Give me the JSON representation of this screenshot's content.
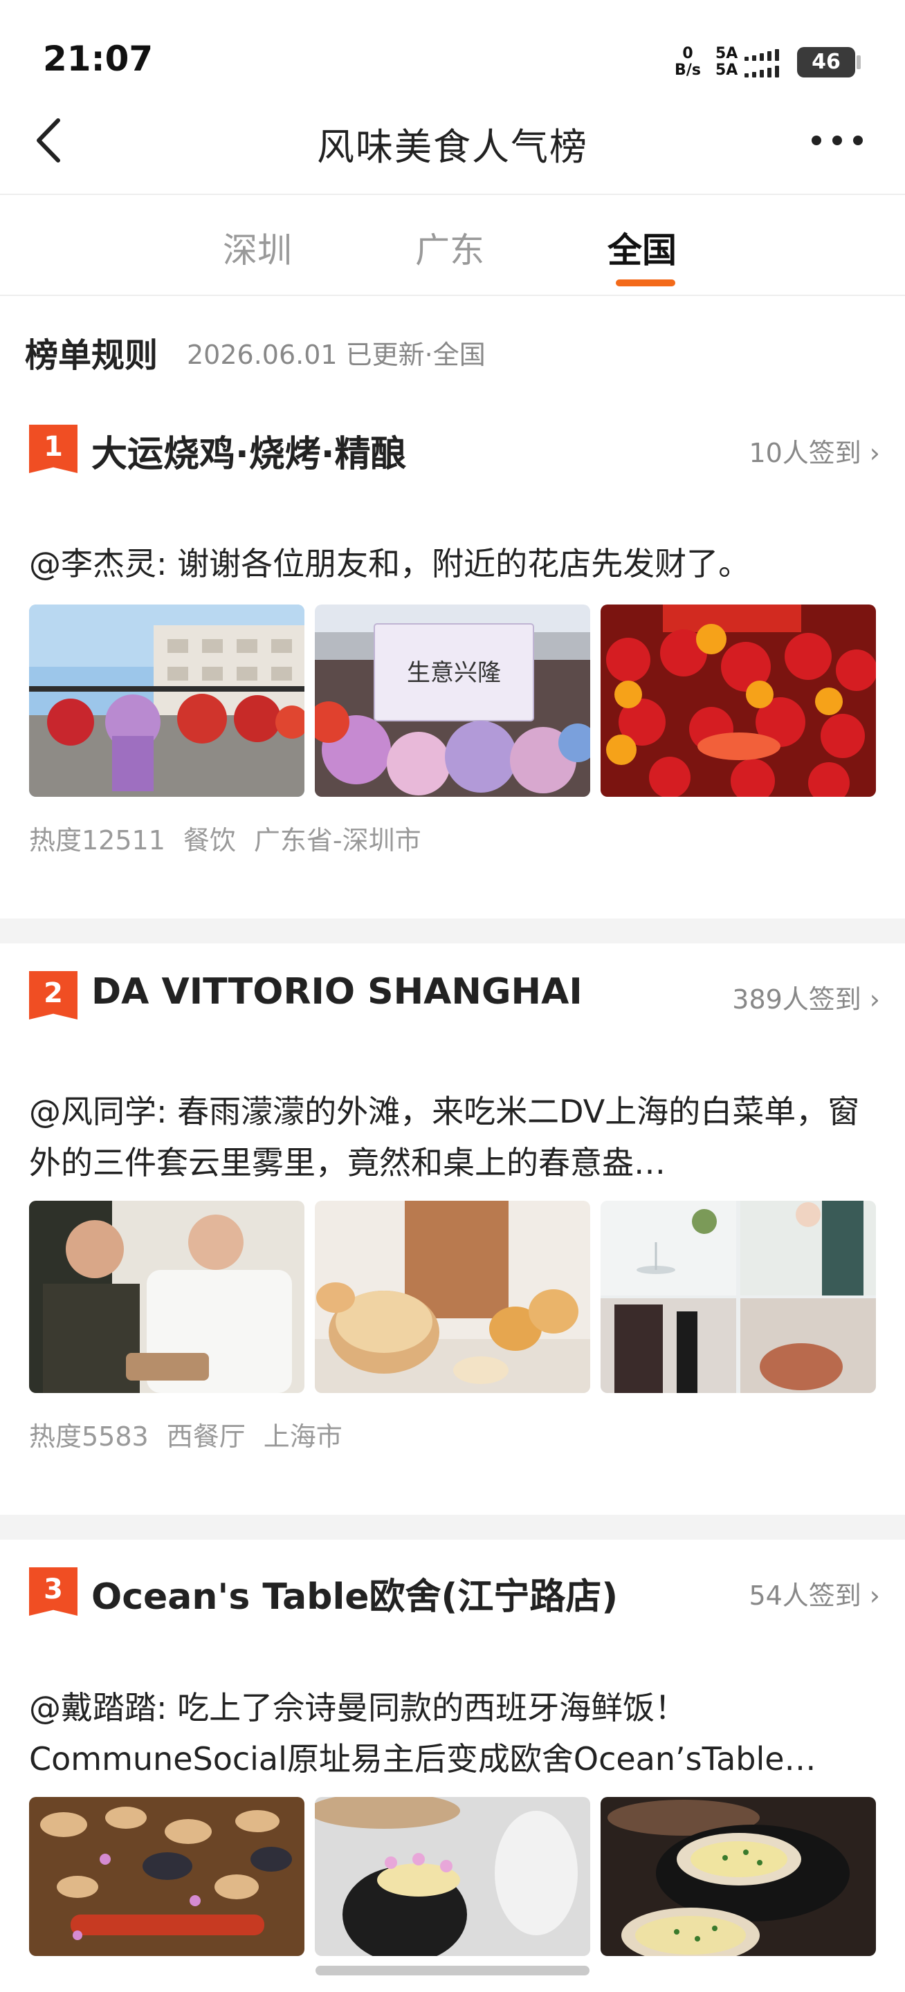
{
  "status_bar": {
    "time": "21:07",
    "net_speed_value": "0",
    "net_speed_unit": "B/s",
    "signal_1": "5A",
    "signal_2": "5A",
    "battery": "46"
  },
  "nav": {
    "title": "风味美食人气榜",
    "back_icon": "chevron-left-icon",
    "more_icon": "more-dots-icon"
  },
  "tabs": [
    {
      "label": "深圳",
      "active": false
    },
    {
      "label": "广东",
      "active": false
    },
    {
      "label": "全国",
      "active": true
    }
  ],
  "accent_color": "#f36a1a",
  "rank_color": "#f04e23",
  "rules": {
    "title": "榜单规则",
    "meta": "2026.06.01 已更新·全国"
  },
  "items": [
    {
      "rank": "1",
      "name": "大运烧鸡·烧烤·精酿",
      "checkins": "10人签到",
      "quote": "@李杰灵: 谢谢各位朋友和，附近的花店先发财了。",
      "photo_sign_text": "生意兴隆",
      "heat": "热度12511",
      "category": "餐饮",
      "location": "广东省-深圳市"
    },
    {
      "rank": "2",
      "name": "DA VITTORIO SHANGHAI",
      "checkins": "389人签到",
      "quote": "@风同学: 春雨濛濛的外滩，来吃米二DV上海的白菜单，窗外的三件套云里雾里，竟然和桌上的春意盎…",
      "heat": "热度5583",
      "category": "西餐厅",
      "location": "上海市"
    },
    {
      "rank": "3",
      "name": "Ocean's Table欧舍(江宁路店)",
      "checkins": "54人签到",
      "quote": "@戴踏踏: 吃上了佘诗曼同款的西班牙海鲜饭！CommuneSocial原址易主后变成欧舍Ocean’sTable…"
    }
  ]
}
